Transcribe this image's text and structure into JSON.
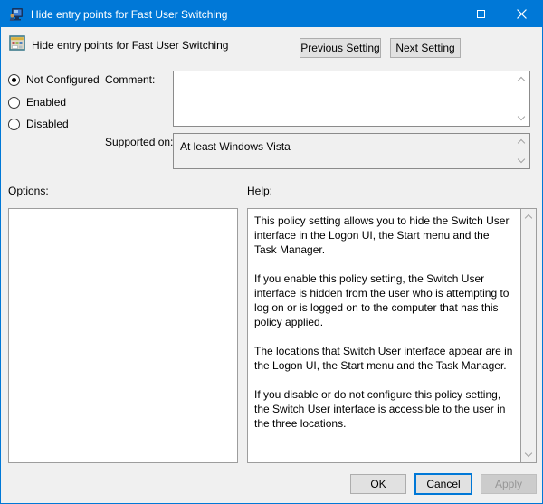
{
  "window": {
    "title": "Hide entry points for Fast User Switching"
  },
  "header": {
    "title": "Hide entry points for Fast User Switching",
    "previous_button": "Previous Setting",
    "next_button": "Next Setting"
  },
  "settings": {
    "radios": [
      {
        "label": "Not Configured",
        "selected": true
      },
      {
        "label": "Enabled",
        "selected": false
      },
      {
        "label": "Disabled",
        "selected": false
      }
    ],
    "comment_label": "Comment:",
    "comment_value": "",
    "supported_label": "Supported on:",
    "supported_value": "At least Windows Vista"
  },
  "panels": {
    "options_label": "Options:",
    "help_label": "Help:",
    "help_paragraphs": [
      "This policy setting allows you to hide the Switch User interface in the Logon UI, the Start menu and the Task Manager.",
      "If you enable this policy setting, the Switch User interface is hidden from the user who is attempting to log on or is logged on to the computer that has this policy applied.",
      "The locations that Switch User interface appear are in the Logon UI, the Start menu and the Task Manager.",
      "If you disable or do not configure this policy setting, the Switch User interface is accessible to the user in the three locations."
    ]
  },
  "footer": {
    "ok_label": "OK",
    "cancel_label": "Cancel",
    "apply_label": "Apply"
  },
  "icons": {
    "titlebar": "computer-user-icon",
    "header": "policy-setting-icon",
    "minimize": "minimize-icon",
    "maximize": "maximize-icon",
    "close": "close-icon"
  },
  "colors": {
    "accent": "#0078D7",
    "dialog_bg": "#F0F0F0",
    "button_bg": "#E1E1E1",
    "button_border": "#ADADAD",
    "box_border": "#8B8B8B",
    "disabled_button_bg": "#CCCCCC",
    "disabled_text": "#969696"
  }
}
